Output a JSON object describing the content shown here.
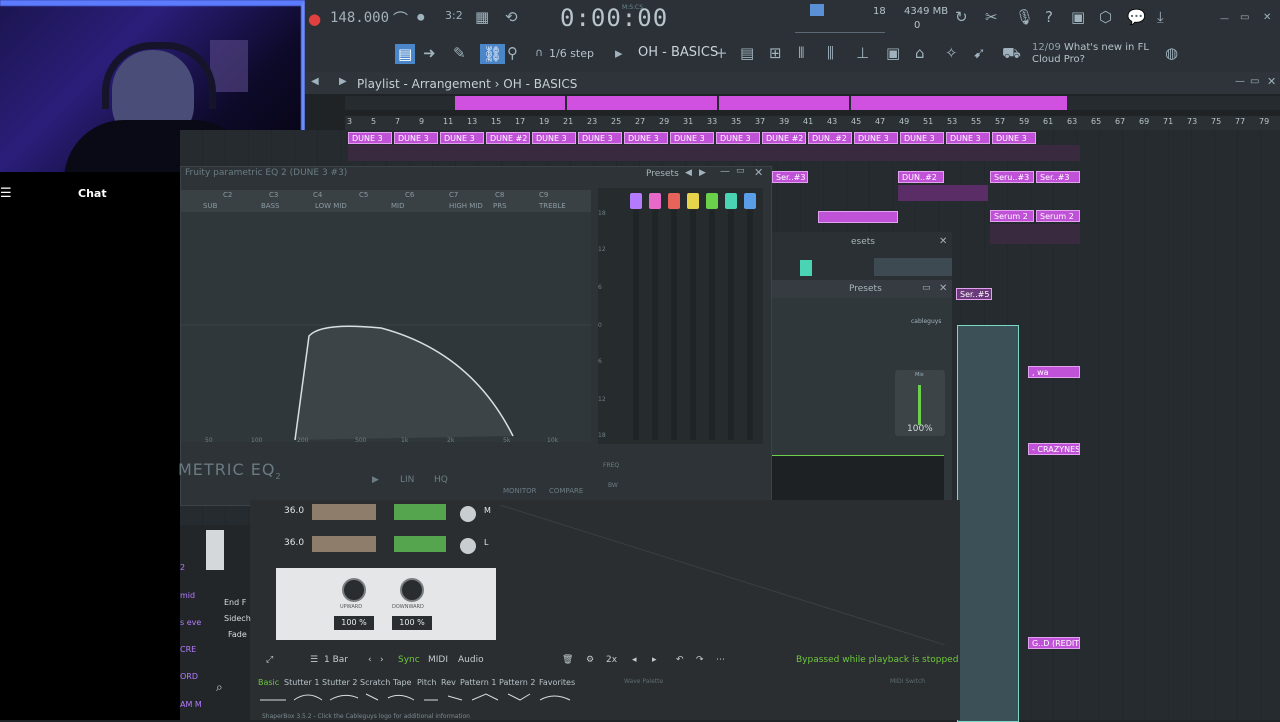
{
  "toolbar": {
    "tempo": "148.000",
    "time": "0:00:00",
    "time_sub": "M:S:CS",
    "cpu": "18",
    "memory": "4349 MB",
    "memory_sub": "0",
    "step": "1/6 step",
    "pattern": "OH - BASICS",
    "news_date": "12/09",
    "news_text": "What's new in FL Cloud Pro?"
  },
  "chat": {
    "title": "Chat"
  },
  "playlist": {
    "title": "Playlist - Arrangement",
    "sep": "›",
    "pattern": "OH - BASICS",
    "ruler": [
      "3",
      "5",
      "7",
      "9",
      "11",
      "13",
      "15",
      "17",
      "19",
      "21",
      "23",
      "25",
      "27",
      "29",
      "31",
      "33",
      "35",
      "37",
      "39",
      "41",
      "43",
      "45",
      "47",
      "49",
      "51",
      "53",
      "55",
      "57",
      "59",
      "61",
      "63",
      "65",
      "67",
      "69",
      "71",
      "73",
      "75",
      "77",
      "79"
    ],
    "clips": {
      "row1": [
        "DUNE 3",
        "DUNE 3",
        "DUNE 3",
        "DUNE #2",
        "DUNE 3",
        "DUNE 3",
        "DUNE 3",
        "DUNE 3",
        "DUNE 3",
        "DUNE #2",
        "DUN..#2",
        "DUNE 3",
        "DUNE 3",
        "DUNE 3",
        "DUNE 3"
      ],
      "ser3": "Ser..#3",
      "dun2": "DUN..#2",
      "seru3": "Seru..#3",
      "ser3b": "Ser..#3",
      "serum2a": "Serum 2",
      "serum2b": "Serum 2",
      "ser5": "Ser..#5",
      "wa": ", wa",
      "crazyness": "- CRAZYNESS",
      "credit": "G..D (REDIT)"
    }
  },
  "eq": {
    "title": "Fruity parametric EQ 2 (DUNE 3 #3)",
    "presets": "Presets",
    "bands": [
      "C1",
      "C2",
      "C3",
      "C4",
      "C5",
      "C6",
      "C7",
      "C8",
      "C9"
    ],
    "band_labels": [
      "SUB",
      "BASS",
      "LOW MID",
      "MID",
      "HIGH MID",
      "PRS",
      "TREBLE"
    ],
    "freqs": [
      "50",
      "100",
      "200",
      "500",
      "1k",
      "2k",
      "5k",
      "10k"
    ],
    "db": [
      "18",
      "12",
      "6",
      "0",
      "6",
      "12",
      "18"
    ],
    "brand": "METRIC EQ",
    "brand_num": "2",
    "buttons": {
      "lin": "LIN",
      "hq": "HQ",
      "monitor": "MONITOR",
      "compare": "COMPARE",
      "freq": "FREQ",
      "bw": "BW"
    }
  },
  "plugin2": {
    "presets": "esets"
  },
  "plugin3": {
    "presets": "Presets",
    "brand": "cableguys",
    "mix_label": "Mix",
    "mix_value": "100%"
  },
  "shaperbox": {
    "rows": [
      {
        "value": "36.0",
        "letter": "M"
      },
      {
        "value": "36.0",
        "letter": "L"
      }
    ],
    "knobs": [
      {
        "label": "UPWARD",
        "value": "100 %"
      },
      {
        "label": "DOWNWARD",
        "value": "100 %"
      }
    ],
    "footer": {
      "bars": "1 Bar",
      "sync": "Sync",
      "midi": "MIDI",
      "audio": "Audio",
      "mult": "2x"
    },
    "bypass": "Bypassed while playback is stopped",
    "tabs": [
      "Basic",
      "Stutter 1",
      "Stutter 2",
      "Scratch",
      "Tape",
      "Pitch",
      "Rev",
      "Pattern 1",
      "Pattern 2",
      "Favorites"
    ],
    "wave_palette": "Wave Palette",
    "midi_switch": "MIDI Switch",
    "status": "ShaperBox 3.5.2 - Click the Cableguys logo for additional information",
    "side_items": [
      "2",
      "mid",
      "s eve",
      "CRE",
      "ORD",
      "AM M"
    ],
    "side_labels": [
      "End F",
      "Sidech",
      "Fade"
    ]
  },
  "colors": {
    "clip": "#c052d8",
    "accent_green": "#6bd14a",
    "bypass": "#6ec73e"
  }
}
